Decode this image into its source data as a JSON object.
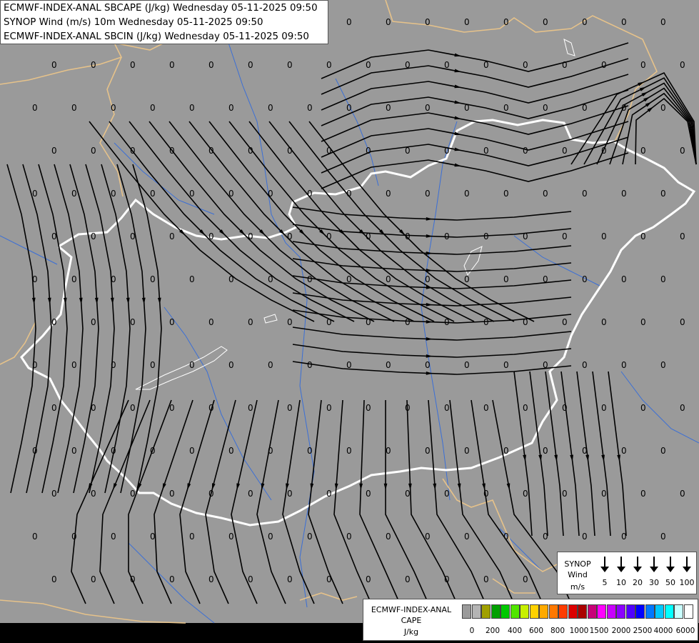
{
  "header": {
    "line1": "ECMWF-INDEX-ANAL SBCAPE (J/kg) Wednesday 05-11-2025 09:50",
    "line2": "SYNOP Wind (m/s) 10m Wednesday 05-11-2025 09:50",
    "line3": "ECMWF-INDEX-ANAL SBCIN (J/kg) Wednesday 05-11-2025 09:50"
  },
  "map": {
    "background_color": "#9a9a9a",
    "hungary_border_color": "#ffffff",
    "country_border_color": "#e6c28a",
    "river_color": "#3b6fd6",
    "streamline_color": "#000000",
    "grid_value_label": "0"
  },
  "synop_legend": {
    "title_line1": "SYNOP",
    "title_line2": "Wind",
    "unit": "m/s",
    "values": [
      "5",
      "10",
      "20",
      "30",
      "50",
      "100"
    ]
  },
  "cape_legend": {
    "title_line1": "ECMWF-INDEX-ANAL",
    "title_line2": "CAPE",
    "unit": "J/kg",
    "colors": [
      "#9a9a9a",
      "#b4b4b4",
      "#a0a000",
      "#00a000",
      "#00c800",
      "#50e600",
      "#c8f000",
      "#ffd200",
      "#ffaa00",
      "#ff7800",
      "#ff3c00",
      "#dc0000",
      "#aa0000",
      "#c80078",
      "#ff00ff",
      "#c800ff",
      "#8c00ff",
      "#5000ff",
      "#0000ff",
      "#0078ff",
      "#00c8ff",
      "#00ffff",
      "#c8ffff",
      "#ffffff"
    ],
    "ticks": [
      "0",
      "200",
      "400",
      "600",
      "800",
      "1000",
      "1500",
      "2000",
      "2500",
      "4000",
      "6000"
    ]
  }
}
